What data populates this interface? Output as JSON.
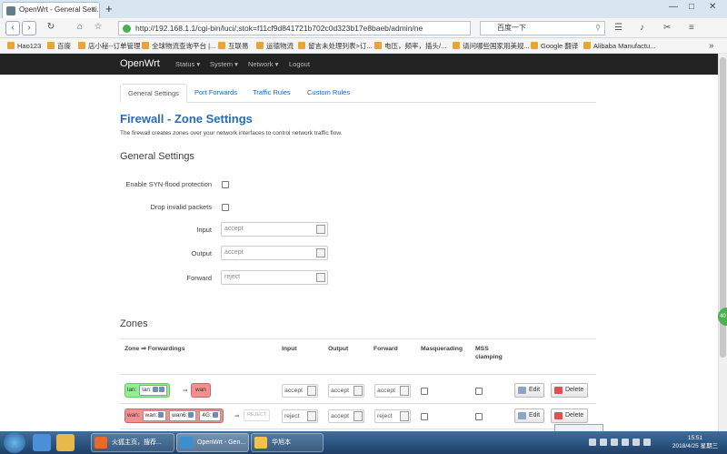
{
  "browser": {
    "tab_title": "OpenWrt - General Setti...",
    "url": "http://192.168.1.1/cgi-bin/luci/;stok=f11cf9d841721b702c0d323b17e8baeb/admin/ne",
    "search_text": "百度一下",
    "bookmarks": [
      "Hao123",
      "百度",
      "店小秘--订单管理",
      "全球物流查询平台 |...",
      "互联易",
      "运德物流",
      "留言未处理列表>订...",
      "电压，频率，插头/...",
      "请问哪些国家用美规...",
      "Google 翻译",
      "Alibaba Manufactu..."
    ]
  },
  "header": {
    "brand": "OpenWrt",
    "menu": [
      "Status ▾",
      "System ▾",
      "Network ▾",
      "Logout"
    ]
  },
  "tabs": [
    "General Settings",
    "Port Forwards",
    "Traffic Rules",
    "Custom Rules"
  ],
  "main": {
    "title": "Firewall - Zone Settings",
    "description": "The firewall creates zones over your network interfaces to control network traffic flow.",
    "general_heading": "General Settings",
    "syn_flood_label": "Enable SYN-flood protection",
    "drop_invalid_label": "Drop invalid packets",
    "input_label": "Input",
    "input_value": "accept",
    "output_label": "Output",
    "output_value": "accept",
    "forward_label": "Forward",
    "forward_value": "reject"
  },
  "zones": {
    "heading": "Zones",
    "columns": [
      "Zone ⇒ Forwardings",
      "Input",
      "Output",
      "Forward",
      "Masquerading",
      "MSS clamping"
    ],
    "rows": [
      {
        "zone": "lan:",
        "networks": [
          "lan:"
        ],
        "arrow": "⇒",
        "dest": "wan",
        "input": "accept",
        "output": "accept",
        "forward": "accept",
        "edit": "Edit",
        "delete": "Delete"
      },
      {
        "zone": "wan:",
        "networks": [
          "wan:",
          "wan6:",
          "4G:"
        ],
        "arrow": "⇒",
        "dest": "REJECT",
        "input": "reject",
        "output": "accept",
        "forward": "reject",
        "edit": "Edit",
        "delete": "Delete"
      }
    ]
  },
  "taskbar": {
    "tasks": [
      "火狐主页，搜荐...",
      "OpenWrt - Gen...",
      "华旭本"
    ],
    "time": "15:51",
    "date": "2018/4/25 星期三"
  },
  "side_badge": "40"
}
